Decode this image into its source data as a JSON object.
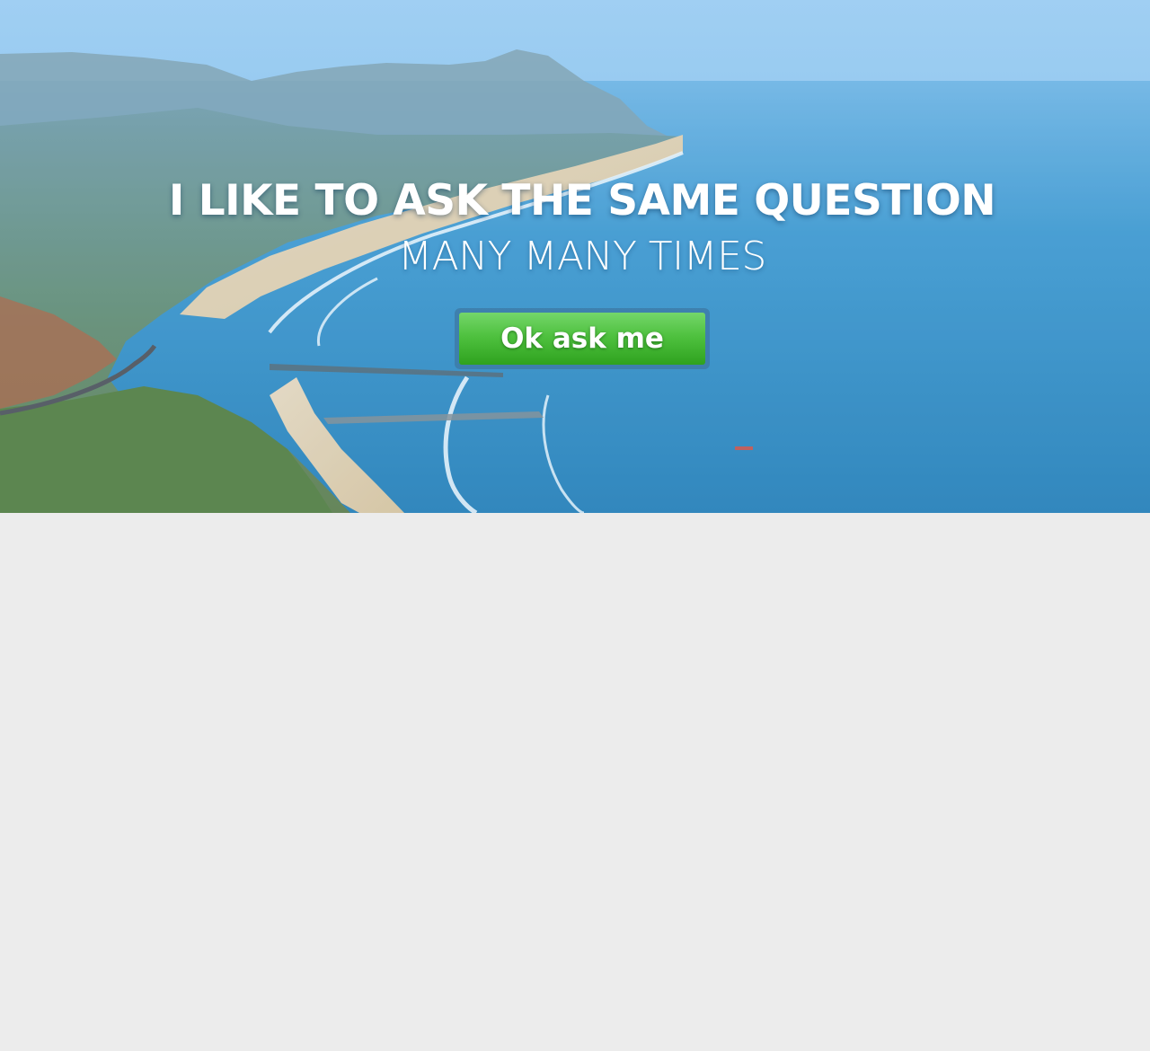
{
  "hero": {
    "headline": "I LIKE TO ASK THE SAME QUESTION",
    "subheadline": "MANY MANY TIMES",
    "cta_label": "Ok ask me",
    "background_image": "coastal-beach-aerial-photo"
  },
  "colors": {
    "page_background": "#ececec",
    "sea": "#2f8fc6",
    "sky": "#8ec5ee",
    "button_green": "#4fc13f",
    "text": "#ffffff"
  }
}
